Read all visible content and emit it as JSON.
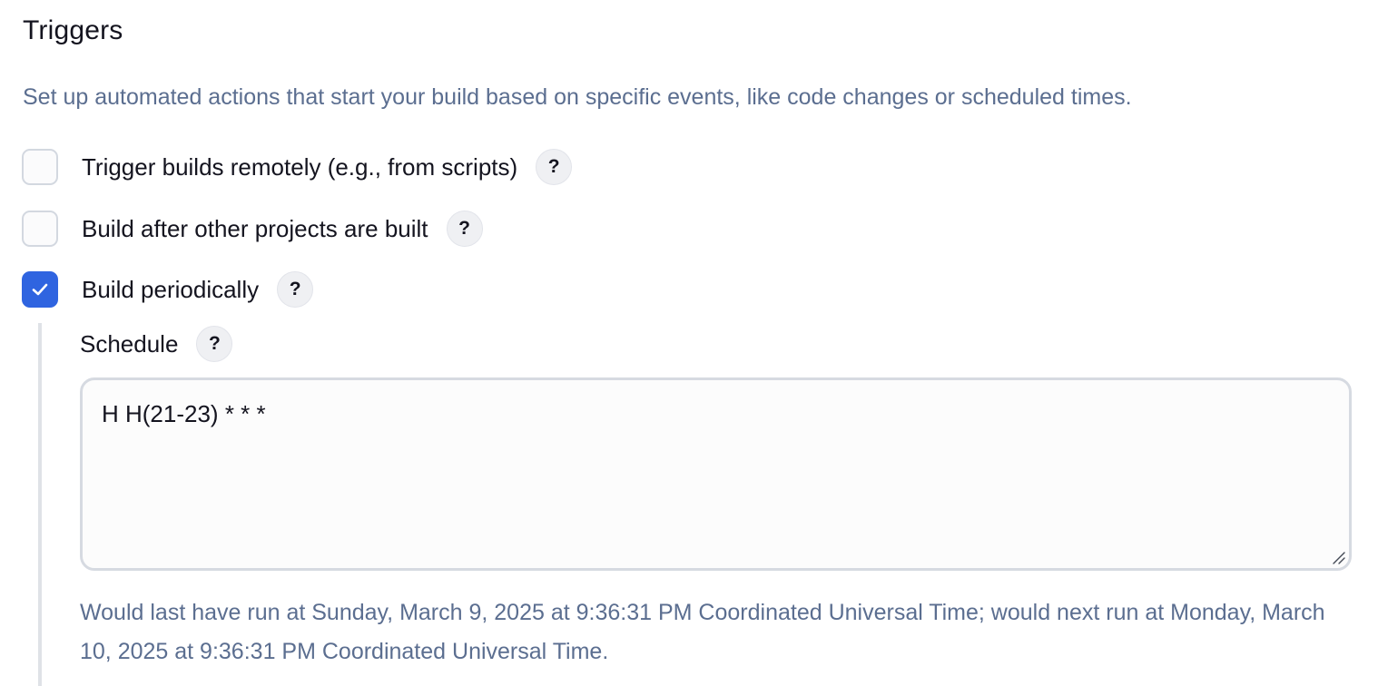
{
  "section": {
    "title": "Triggers",
    "description": "Set up automated actions that start your build based on specific events, like code changes or scheduled times."
  },
  "triggers": [
    {
      "label": "Trigger builds remotely (e.g., from scripts)",
      "checked": false,
      "help": "?"
    },
    {
      "label": "Build after other projects are built",
      "checked": false,
      "help": "?"
    },
    {
      "label": "Build periodically",
      "checked": true,
      "help": "?"
    }
  ],
  "schedule": {
    "label": "Schedule",
    "help": "?",
    "value": "H H(21-23) * * *",
    "info": "Would last have run at Sunday, March 9, 2025 at 9:36:31 PM Coordinated Universal Time; would next run at Monday, March 10, 2025 at 9:36:31 PM Coordinated Universal Time."
  },
  "colors": {
    "accent": "#2f64e0",
    "muted_text": "#5b6e90",
    "text": "#14141f",
    "border": "#d3d8e0"
  },
  "icons": {
    "check": "check-icon",
    "help": "help-icon",
    "resize": "resize-handle-icon"
  }
}
